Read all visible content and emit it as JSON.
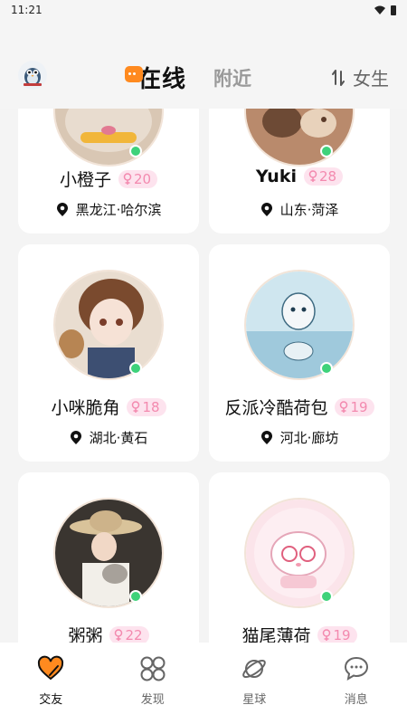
{
  "status_bar": {
    "time": "11:21"
  },
  "header": {
    "tab_online": "在线",
    "tab_nearby": "附近",
    "gender_filter": "女生"
  },
  "cards": [
    {
      "name": "小橙子",
      "age": "20",
      "location": "黑龙江·哈尔滨"
    },
    {
      "name": "Yuki",
      "age": "28",
      "location": "山东·菏泽"
    },
    {
      "name": "小咪脆角",
      "age": "18",
      "location": "湖北·黄石"
    },
    {
      "name": "反派冷酷荷包",
      "age": "19",
      "location": "河北·廊坊"
    },
    {
      "name": "粥粥",
      "age": "22",
      "location": ""
    },
    {
      "name": "猫尾薄荷",
      "age": "19",
      "location": ""
    }
  ],
  "bottom_nav": [
    {
      "label": "交友",
      "icon": "heart-icon",
      "active": true
    },
    {
      "label": "发现",
      "icon": "grid-icon",
      "active": false
    },
    {
      "label": "星球",
      "icon": "planet-icon",
      "active": false
    },
    {
      "label": "消息",
      "icon": "chat-icon",
      "active": false
    }
  ],
  "colors": {
    "accent": "#ff8a1f",
    "online": "#3ed27a",
    "age_badge_bg": "#fde3ee",
    "age_badge_text": "#f38aaf"
  }
}
